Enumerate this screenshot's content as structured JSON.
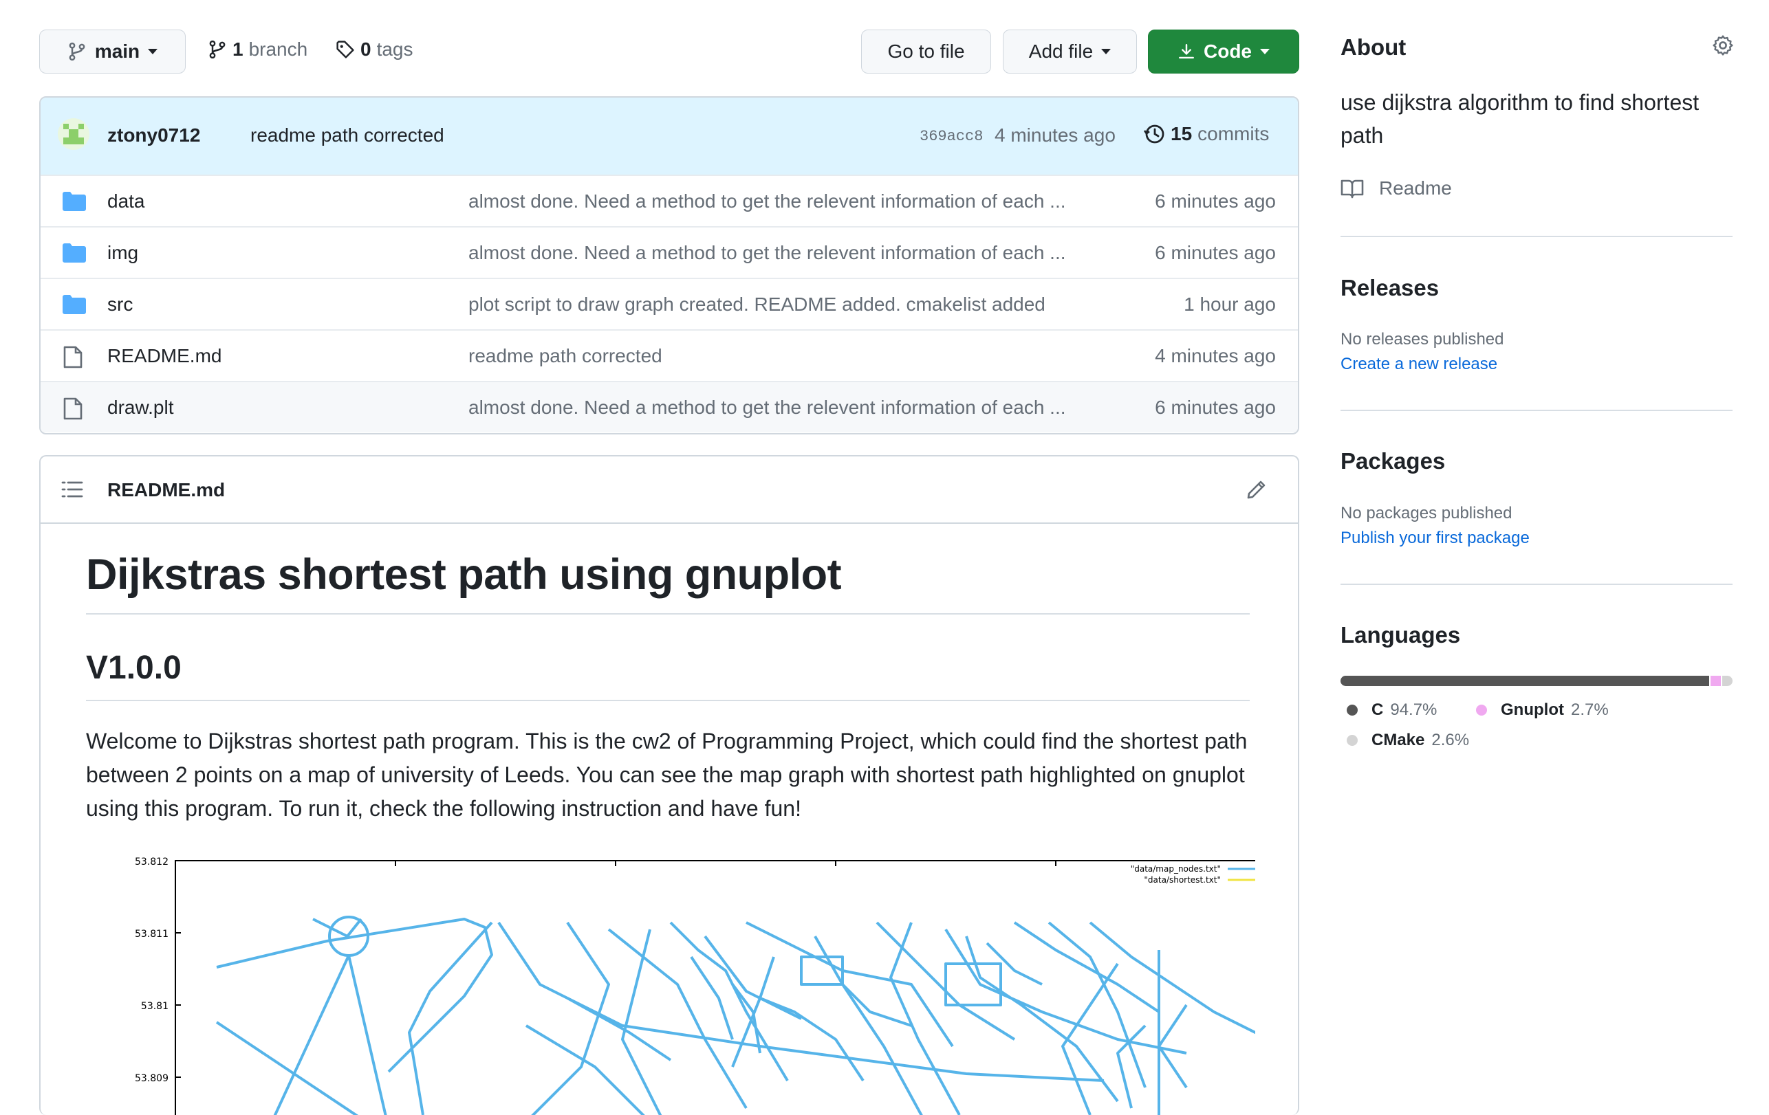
{
  "toolbar": {
    "branch_label": "main",
    "branches_count": "1",
    "branches_label": "branch",
    "tags_count": "0",
    "tags_label": "tags",
    "go_to_file": "Go to file",
    "add_file": "Add file",
    "code": "Code"
  },
  "commit": {
    "author": "ztony0712",
    "message": "readme path corrected",
    "sha": "369acc8",
    "time": "4 minutes ago",
    "count": "15",
    "count_label": "commits"
  },
  "files": [
    {
      "type": "folder",
      "name": "data",
      "message": "almost done. Need a method to get the relevent information of each ...",
      "time": "6 minutes ago"
    },
    {
      "type": "folder",
      "name": "img",
      "message": "almost done. Need a method to get the relevent information of each ...",
      "time": "6 minutes ago"
    },
    {
      "type": "folder",
      "name": "src",
      "message": "plot script to draw graph created. README added. cmakelist added",
      "time": "1 hour ago"
    },
    {
      "type": "file",
      "name": "README.md",
      "message": "readme path corrected",
      "time": "4 minutes ago"
    },
    {
      "type": "file",
      "name": "draw.plt",
      "message": "almost done. Need a method to get the relevent information of each ...",
      "time": "6 minutes ago"
    }
  ],
  "readme": {
    "filename": "README.md",
    "h1": "Dijkstras shortest path using gnuplot",
    "h2": "V1.0.0",
    "paragraph": "Welcome to Dijkstras shortest path program. This is the cw2 of Programming Project, which could find the shortest path between 2 points on a map of university of Leeds. You can see the map graph with shortest path highlighted on gnuplot using this program. To run it, check the following instruction and have fun!",
    "plot": {
      "yticks": [
        "53.812",
        "53.811",
        "53.81",
        "53.809"
      ],
      "legend": [
        "\"data/map_nodes.txt\"",
        "\"data/shortest.txt\""
      ],
      "colors": {
        "map": "#56b4e9",
        "shortest": "#f0e442"
      }
    }
  },
  "about": {
    "title": "About",
    "description": "use dijkstra algorithm to find shortest path",
    "readme_link": "Readme"
  },
  "releases": {
    "title": "Releases",
    "status": "No releases published",
    "link": "Create a new release"
  },
  "packages": {
    "title": "Packages",
    "status": "No packages published",
    "link": "Publish your first package"
  },
  "languages": {
    "title": "Languages",
    "items": [
      {
        "name": "C",
        "percent": "94.7%",
        "value": 94.7,
        "color": "#555555"
      },
      {
        "name": "Gnuplot",
        "percent": "2.7%",
        "value": 2.7,
        "color": "#f0a9f0"
      },
      {
        "name": "CMake",
        "percent": "2.6%",
        "value": 2.6,
        "color": "#d4d4d4"
      }
    ]
  }
}
